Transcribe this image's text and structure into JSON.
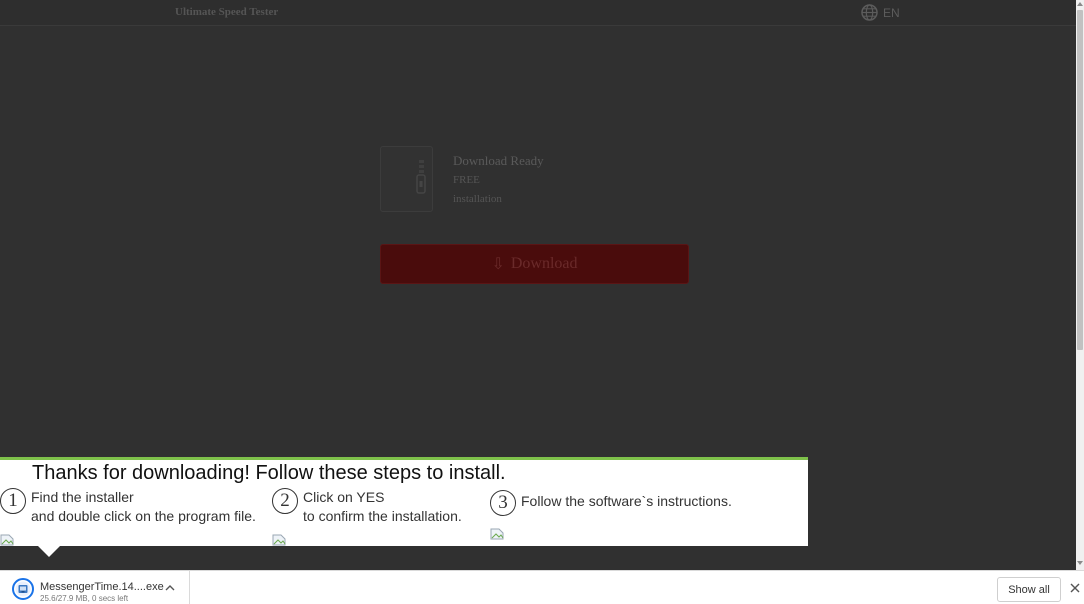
{
  "site": {
    "brand": "Ultimate Speed Tester",
    "language": "EN"
  },
  "download_card": {
    "title": "Download Ready",
    "price": "FREE",
    "type": "installation",
    "button_label": "Download",
    "button_icon": "⇩"
  },
  "install_overlay": {
    "title": "Thanks for downloading! Follow these steps to install.",
    "steps": [
      {
        "number": "1",
        "line1": "Find the installer",
        "line2": "and double click on the program file."
      },
      {
        "number": "2",
        "line1": "Click on YES",
        "line2": "to confirm the installation."
      },
      {
        "number": "3",
        "line1": "Follow the software`s instructions.",
        "line2": ""
      }
    ],
    "accent_color": "#7ec14a"
  },
  "download_shelf": {
    "file_name": "MessengerTime.14....exe",
    "progress": "25.6/27.9 MB, 0 secs left",
    "show_all_label": "Show all"
  }
}
